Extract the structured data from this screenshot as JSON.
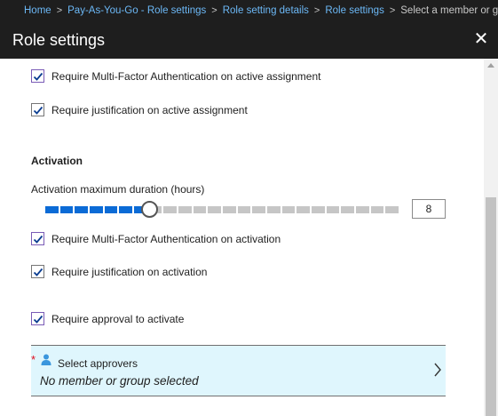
{
  "breadcrumb": {
    "items": [
      "Home",
      "Pay-As-You-Go - Role settings",
      "Role setting details",
      "Role settings",
      "Select a member or group"
    ],
    "separator": ">"
  },
  "window": {
    "title": "Role settings",
    "close_glyph": "✕"
  },
  "assignment": {
    "mfa_label": "Require Multi-Factor Authentication on active assignment",
    "mfa_checked": true,
    "justification_label": "Require justification on active assignment",
    "justification_checked": true
  },
  "activation": {
    "heading": "Activation",
    "duration_label": "Activation maximum duration (hours)",
    "duration_value": "8",
    "duration_max": 24,
    "mfa_label": "Require Multi-Factor Authentication on activation",
    "mfa_checked": true,
    "justification_label": "Require justification on activation",
    "justification_checked": true,
    "approval_label": "Require approval to activate",
    "approval_checked": true
  },
  "approvers": {
    "required_marker": "*",
    "label": "Select approvers",
    "value": "No member or group selected"
  },
  "icons": {
    "checkmark": "checkmark-icon",
    "person": "person-icon",
    "chevron": "chevron-right-icon",
    "close": "close-icon"
  },
  "colors": {
    "header_bg": "#1e1e1e",
    "link": "#6cb8f6",
    "slider_fill": "#0b6bd6",
    "approvers_bg": "#dff6fd",
    "required": "#e00b1c"
  }
}
